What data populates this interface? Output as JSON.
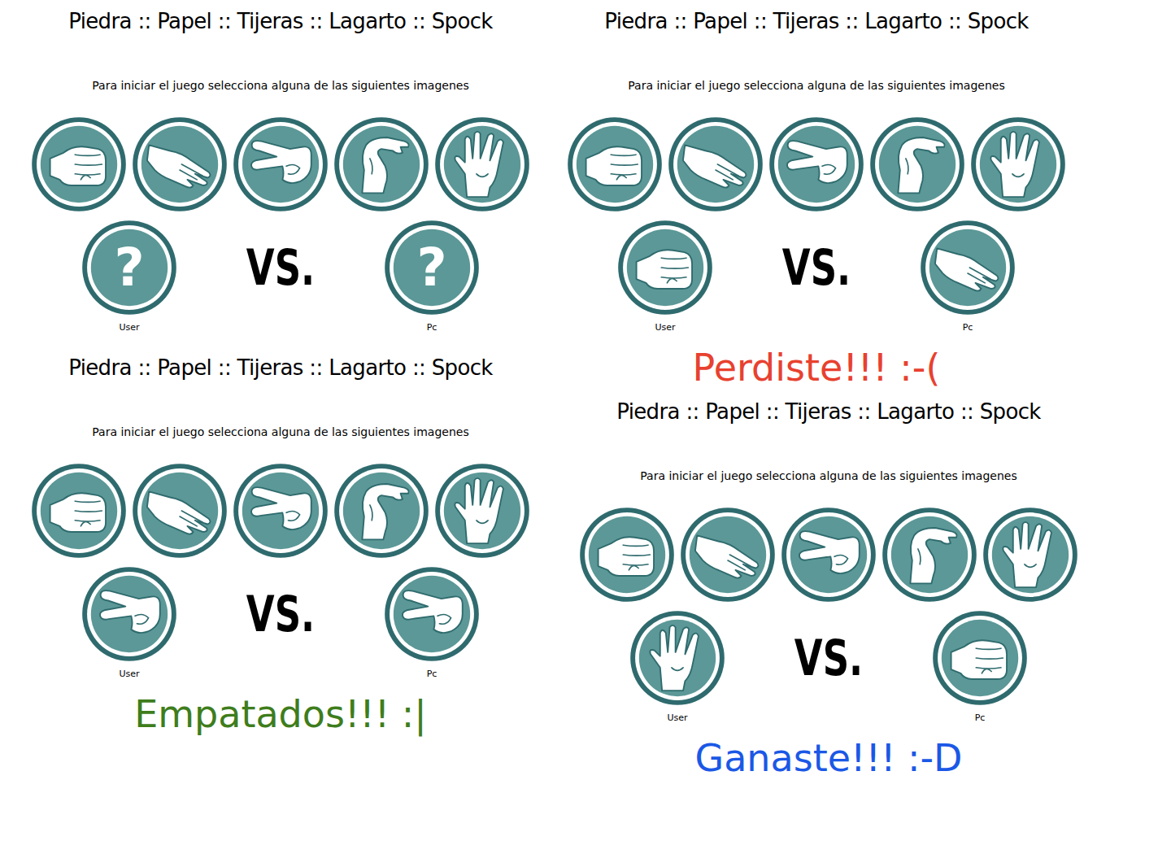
{
  "panels": [
    {
      "title": "Piedra :: Papel :: Tijeras :: Lagarto :: Spock",
      "instruction": "Para iniciar el juego selecciona alguna de las siguientes imagenes",
      "options": [
        {
          "kind": "piedra"
        },
        {
          "kind": "papel"
        },
        {
          "kind": "tijeras"
        },
        {
          "kind": "lagarto"
        },
        {
          "kind": "spock"
        }
      ],
      "user": {
        "kind": "unknown",
        "glyph": "?",
        "label": "User"
      },
      "vs": "VS.",
      "pc": {
        "kind": "unknown",
        "glyph": "?",
        "label": "Pc"
      }
    },
    {
      "title": "Piedra :: Papel :: Tijeras :: Lagarto :: Spock",
      "instruction": "Para iniciar el juego selecciona alguna de las siguientes imagenes",
      "options": [
        {
          "kind": "piedra"
        },
        {
          "kind": "papel"
        },
        {
          "kind": "tijeras"
        },
        {
          "kind": "lagarto"
        },
        {
          "kind": "spock"
        }
      ],
      "user": {
        "kind": "piedra",
        "label": "User"
      },
      "vs": "VS.",
      "pc": {
        "kind": "papel",
        "label": "Pc"
      },
      "result": {
        "text": "Perdiste!!! :-(",
        "color": "#e8412f"
      }
    },
    {
      "title": "Piedra :: Papel :: Tijeras :: Lagarto :: Spock",
      "instruction": "Para iniciar el juego selecciona alguna de las siguientes imagenes",
      "options": [
        {
          "kind": "piedra"
        },
        {
          "kind": "papel"
        },
        {
          "kind": "tijeras"
        },
        {
          "kind": "lagarto"
        },
        {
          "kind": "spock"
        }
      ],
      "user": {
        "kind": "tijeras",
        "label": "User"
      },
      "vs": "VS.",
      "pc": {
        "kind": "tijeras",
        "label": "Pc"
      },
      "result": {
        "text": "Empatados!!! :|",
        "color": "#3e7d1c"
      }
    },
    {
      "title": "Piedra :: Papel :: Tijeras :: Lagarto :: Spock",
      "instruction": "Para iniciar el juego selecciona alguna de las siguientes imagenes",
      "options": [
        {
          "kind": "piedra"
        },
        {
          "kind": "papel"
        },
        {
          "kind": "tijeras"
        },
        {
          "kind": "lagarto"
        },
        {
          "kind": "spock"
        }
      ],
      "user": {
        "kind": "spock",
        "label": "User"
      },
      "vs": "VS.",
      "pc": {
        "kind": "piedra",
        "label": "Pc"
      },
      "result": {
        "text": "Ganaste!!! :-D",
        "color": "#1b58e6"
      }
    }
  ]
}
